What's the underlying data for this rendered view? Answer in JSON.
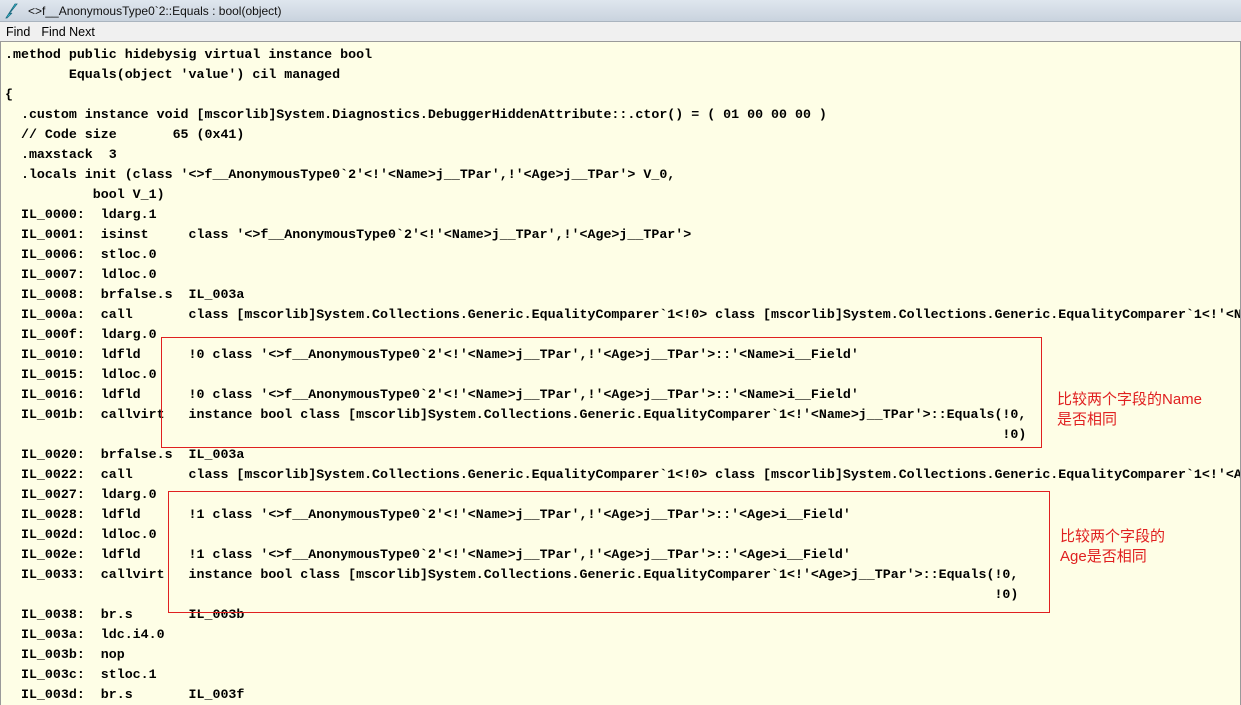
{
  "window": {
    "title": "<>f__AnonymousType0`2::Equals : bool(object)"
  },
  "menu": {
    "find": "Find",
    "find_next": "Find Next"
  },
  "code_lines": [
    ".method public hidebysig virtual instance bool",
    "        Equals(object 'value') cil managed",
    "{",
    "  .custom instance void [mscorlib]System.Diagnostics.DebuggerHiddenAttribute::.ctor() = ( 01 00 00 00 )",
    "  // Code size       65 (0x41)",
    "  .maxstack  3",
    "  .locals init (class '<>f__AnonymousType0`2'<!'<Name>j__TPar',!'<Age>j__TPar'> V_0,",
    "           bool V_1)",
    "  IL_0000:  ldarg.1",
    "  IL_0001:  isinst     class '<>f__AnonymousType0`2'<!'<Name>j__TPar',!'<Age>j__TPar'>",
    "  IL_0006:  stloc.0",
    "  IL_0007:  ldloc.0",
    "  IL_0008:  brfalse.s  IL_003a",
    "  IL_000a:  call       class [mscorlib]System.Collections.Generic.EqualityComparer`1<!0> class [mscorlib]System.Collections.Generic.EqualityComparer`1<!'<N",
    "  IL_000f:  ldarg.0",
    "  IL_0010:  ldfld      !0 class '<>f__AnonymousType0`2'<!'<Name>j__TPar',!'<Age>j__TPar'>::'<Name>i__Field'",
    "  IL_0015:  ldloc.0",
    "  IL_0016:  ldfld      !0 class '<>f__AnonymousType0`2'<!'<Name>j__TPar',!'<Age>j__TPar'>::'<Name>i__Field'",
    "  IL_001b:  callvirt   instance bool class [mscorlib]System.Collections.Generic.EqualityComparer`1<!'<Name>j__TPar'>::Equals(!0,",
    "                                                                                                                             !0)",
    "  IL_0020:  brfalse.s  IL_003a",
    "  IL_0022:  call       class [mscorlib]System.Collections.Generic.EqualityComparer`1<!0> class [mscorlib]System.Collections.Generic.EqualityComparer`1<!'<A",
    "  IL_0027:  ldarg.0",
    "  IL_0028:  ldfld      !1 class '<>f__AnonymousType0`2'<!'<Name>j__TPar',!'<Age>j__TPar'>::'<Age>i__Field'",
    "  IL_002d:  ldloc.0",
    "  IL_002e:  ldfld      !1 class '<>f__AnonymousType0`2'<!'<Name>j__TPar',!'<Age>j__TPar'>::'<Age>i__Field'",
    "  IL_0033:  callvirt   instance bool class [mscorlib]System.Collections.Generic.EqualityComparer`1<!'<Age>j__TPar'>::Equals(!0,",
    "                                                                                                                            !0)",
    "  IL_0038:  br.s       IL_003b",
    "  IL_003a:  ldc.i4.0",
    "  IL_003b:  nop",
    "  IL_003c:  stloc.1",
    "  IL_003d:  br.s       IL_003f"
  ],
  "annotations": {
    "name_note": "比较两个字段的Name\n是否相同",
    "age_note": "比较两个字段的\nAge是否相同"
  },
  "colors": {
    "annotation": "#e02020",
    "background": "#fefee6"
  }
}
